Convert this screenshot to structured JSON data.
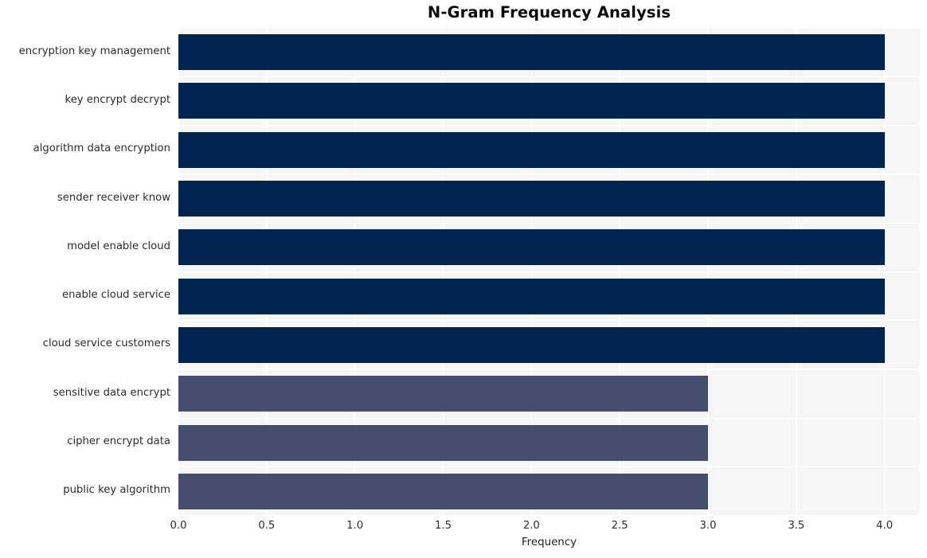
{
  "chart_data": {
    "type": "bar",
    "orientation": "horizontal",
    "title": "N-Gram Frequency Analysis",
    "xlabel": "Frequency",
    "ylabel": "",
    "categories": [
      "encryption key management",
      "key encrypt decrypt",
      "algorithm data encryption",
      "sender receiver know",
      "model enable cloud",
      "enable cloud service",
      "cloud service customers",
      "sensitive data encrypt",
      "cipher encrypt data",
      "public key algorithm"
    ],
    "values": [
      4,
      4,
      4,
      4,
      4,
      4,
      4,
      3,
      3,
      3
    ],
    "bar_colors": [
      "#022450",
      "#022450",
      "#022450",
      "#022450",
      "#022450",
      "#022450",
      "#022450",
      "#454e6e",
      "#454e6e",
      "#454e6e"
    ],
    "xlim": [
      0.0,
      4.2
    ],
    "xticks": [
      "0.0",
      "0.5",
      "1.0",
      "1.5",
      "2.0",
      "2.5",
      "3.0",
      "3.5",
      "4.0"
    ],
    "xtick_values": [
      0.0,
      0.5,
      1.0,
      1.5,
      2.0,
      2.5,
      3.0,
      3.5,
      4.0
    ],
    "grid": true,
    "legend": null,
    "plot_background": "#f6f6f7",
    "grid_color": "#ffffff",
    "figure_background": "#ffffff"
  }
}
